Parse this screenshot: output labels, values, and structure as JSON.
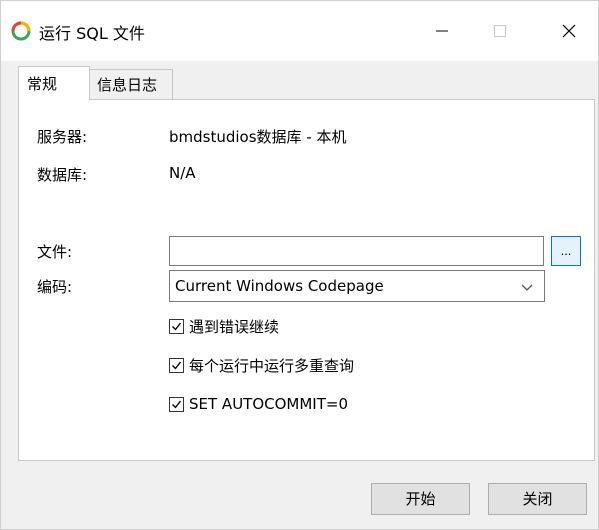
{
  "window": {
    "title": "运行 SQL 文件",
    "controls": {
      "minimize": "—",
      "maximize": "□",
      "close": "×"
    }
  },
  "tabs": [
    {
      "label": "常规",
      "active": true
    },
    {
      "label": "信息日志",
      "active": false
    }
  ],
  "form": {
    "server_label": "服务器:",
    "server_value": "bmdstudios数据库 - 本机",
    "database_label": "数据库:",
    "database_value": "N/A",
    "file_label": "文件:",
    "file_value": "",
    "browse_label": "...",
    "encoding_label": "编码:",
    "encoding_value": "Current Windows Codepage"
  },
  "options": [
    {
      "label": "遇到错误继续",
      "checked": true
    },
    {
      "label": "每个运行中运行多重查询",
      "checked": true
    },
    {
      "label": "SET AUTOCOMMIT=0",
      "checked": true
    }
  ],
  "buttons": {
    "start": "开始",
    "close": "关闭"
  },
  "colors": {
    "accent": "#0078d7",
    "client_bg": "#f0f0f0"
  },
  "icons": {
    "app": "navicat-app-icon",
    "dropdown": "chevron-down-icon",
    "check": "checkmark-icon"
  }
}
